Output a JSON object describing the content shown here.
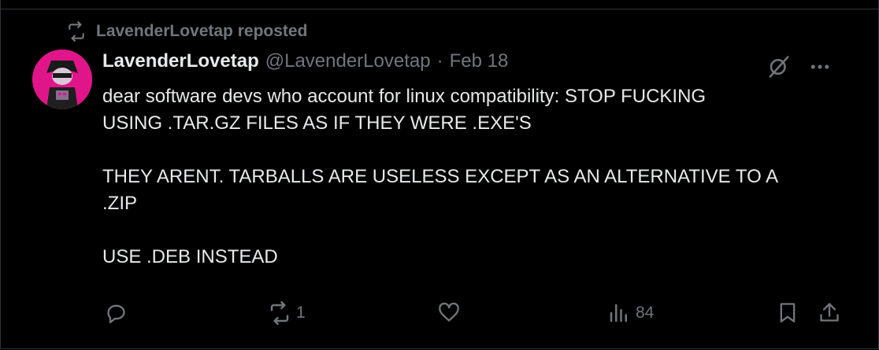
{
  "repost": {
    "icon": "repost-icon",
    "label": "LavenderLovetap reposted"
  },
  "tweet": {
    "avatar_color": "#e0158a",
    "display_name": "LavenderLovetap",
    "handle": "@LavenderLovetap",
    "separator": "·",
    "date": "Feb 18",
    "lines": [
      "dear software devs who account for linux compatibility: STOP FUCKING",
      "USING .TAR.GZ FILES AS IF THEY WERE .EXE'S",
      "THEY ARENT. TARBALLS ARE USELESS EXCEPT AS AN ALTERNATIVE TO A",
      ".ZIP",
      "USE .DEB INSTEAD"
    ]
  },
  "actions": {
    "reply": {
      "icon": "reply-icon",
      "count": ""
    },
    "repost": {
      "icon": "repost-icon",
      "count": "1"
    },
    "like": {
      "icon": "like-icon",
      "count": ""
    },
    "views": {
      "icon": "views-icon",
      "count": "84"
    },
    "bookmark": {
      "icon": "bookmark-icon"
    },
    "share": {
      "icon": "share-icon"
    }
  },
  "top_icons": [
    "grok-icon",
    "more-icon"
  ],
  "colors": {
    "background": "#000000",
    "text": "#e7e9ea",
    "muted": "#71767b",
    "border": "#2f3336"
  }
}
